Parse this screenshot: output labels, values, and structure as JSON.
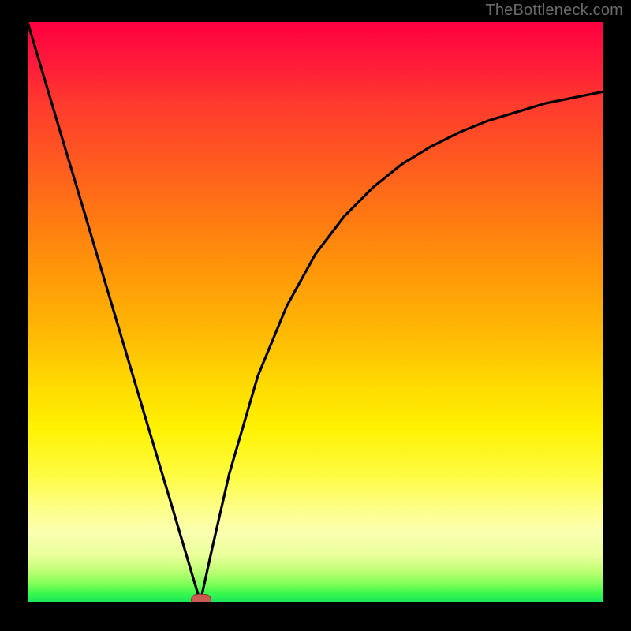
{
  "watermark": "TheBottleneck.com",
  "colors": {
    "frame": "#000000",
    "curve": "#000000",
    "marker_fill": "#c95b52",
    "marker_border": "#8d3a34"
  },
  "chart_data": {
    "type": "line",
    "title": "",
    "xlabel": "",
    "ylabel": "",
    "xlim": [
      0,
      100
    ],
    "ylim": [
      0,
      100
    ],
    "grid": false,
    "legend": false,
    "background": "vertical-gradient red→yellow→green",
    "series": [
      {
        "name": "left-branch",
        "x": [
          0,
          5,
          10,
          15,
          20,
          25,
          27,
          29,
          30
        ],
        "y": [
          100,
          83.3,
          66.7,
          50,
          33.3,
          16.7,
          10,
          3.3,
          0
        ]
      },
      {
        "name": "right-branch",
        "x": [
          30,
          32,
          35,
          40,
          45,
          50,
          55,
          60,
          65,
          70,
          75,
          80,
          85,
          90,
          95,
          100
        ],
        "y": [
          0,
          9,
          22,
          39,
          51,
          60,
          66.5,
          71.5,
          75.5,
          78.5,
          81,
          83,
          84.5,
          86,
          87,
          88
        ]
      }
    ],
    "marker": {
      "x": 30,
      "y": 0,
      "shape": "rounded-rect",
      "color": "#c95b52"
    }
  }
}
